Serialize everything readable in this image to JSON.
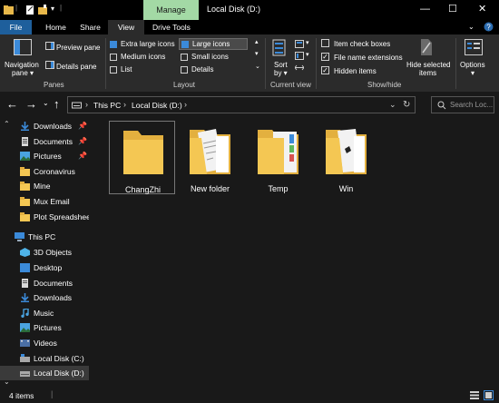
{
  "titlebar": {
    "manage_label": "Manage",
    "window_title": "Local Disk (D:)"
  },
  "tabs": [
    {
      "label": "File"
    },
    {
      "label": "Home"
    },
    {
      "label": "Share"
    },
    {
      "label": "View"
    },
    {
      "label": "Drive Tools"
    }
  ],
  "ribbon": {
    "panes": {
      "navigation_pane_line1": "Navigation",
      "navigation_pane_line2": "pane ▾",
      "preview_pane": "Preview pane",
      "details_pane": "Details pane",
      "group_label": "Panes"
    },
    "layout": {
      "items": [
        {
          "label": "Extra large icons"
        },
        {
          "label": "Large icons"
        },
        {
          "label": "Medium icons"
        },
        {
          "label": "Small icons"
        },
        {
          "label": "List"
        },
        {
          "label": "Details"
        }
      ],
      "selected": "Large icons",
      "group_label": "Layout"
    },
    "current_view": {
      "sort_by_line1": "Sort",
      "sort_by_line2": "by ▾",
      "group_label": "Current view"
    },
    "show_hide": {
      "item_check_boxes": "Item check boxes",
      "item_check_boxes_checked": false,
      "file_name_extensions": "File name extensions",
      "file_name_extensions_checked": true,
      "hidden_items": "Hidden items",
      "hidden_items_checked": true,
      "hide_selected_line1": "Hide selected",
      "hide_selected_line2": "items",
      "group_label": "Show/hide"
    },
    "options_line1": "Options",
    "options_line2": "▾"
  },
  "address": {
    "crumbs": [
      "This PC",
      "Local Disk (D:)"
    ],
    "search_placeholder": "Search Loc..."
  },
  "nav": {
    "quick_access": [
      {
        "label": "Downloads",
        "pinned": true
      },
      {
        "label": "Documents",
        "pinned": true
      },
      {
        "label": "Pictures",
        "pinned": true
      },
      {
        "label": "Coronavirus",
        "pinned": false
      },
      {
        "label": "Mine",
        "pinned": false
      },
      {
        "label": "Mux Email",
        "pinned": false
      },
      {
        "label": "Plot Spreadshee",
        "pinned": false
      }
    ],
    "this_pc": {
      "label": "This PC"
    },
    "this_pc_items": [
      {
        "label": "3D Objects"
      },
      {
        "label": "Desktop"
      },
      {
        "label": "Documents"
      },
      {
        "label": "Downloads"
      },
      {
        "label": "Music"
      },
      {
        "label": "Pictures"
      },
      {
        "label": "Videos"
      },
      {
        "label": "Local Disk (C:)"
      },
      {
        "label": "Local Disk (D:)"
      }
    ]
  },
  "folders": [
    {
      "name": "ChangZhi"
    },
    {
      "name": "New folder"
    },
    {
      "name": "Temp"
    },
    {
      "name": "Win"
    }
  ],
  "status": {
    "item_count": "4 items"
  },
  "colors": {
    "file_tab": "#1e5f9c",
    "manage_tab": "#a3d9a5",
    "folder_yellow": "#f4c753",
    "selected_row": "#3a3a3a"
  }
}
